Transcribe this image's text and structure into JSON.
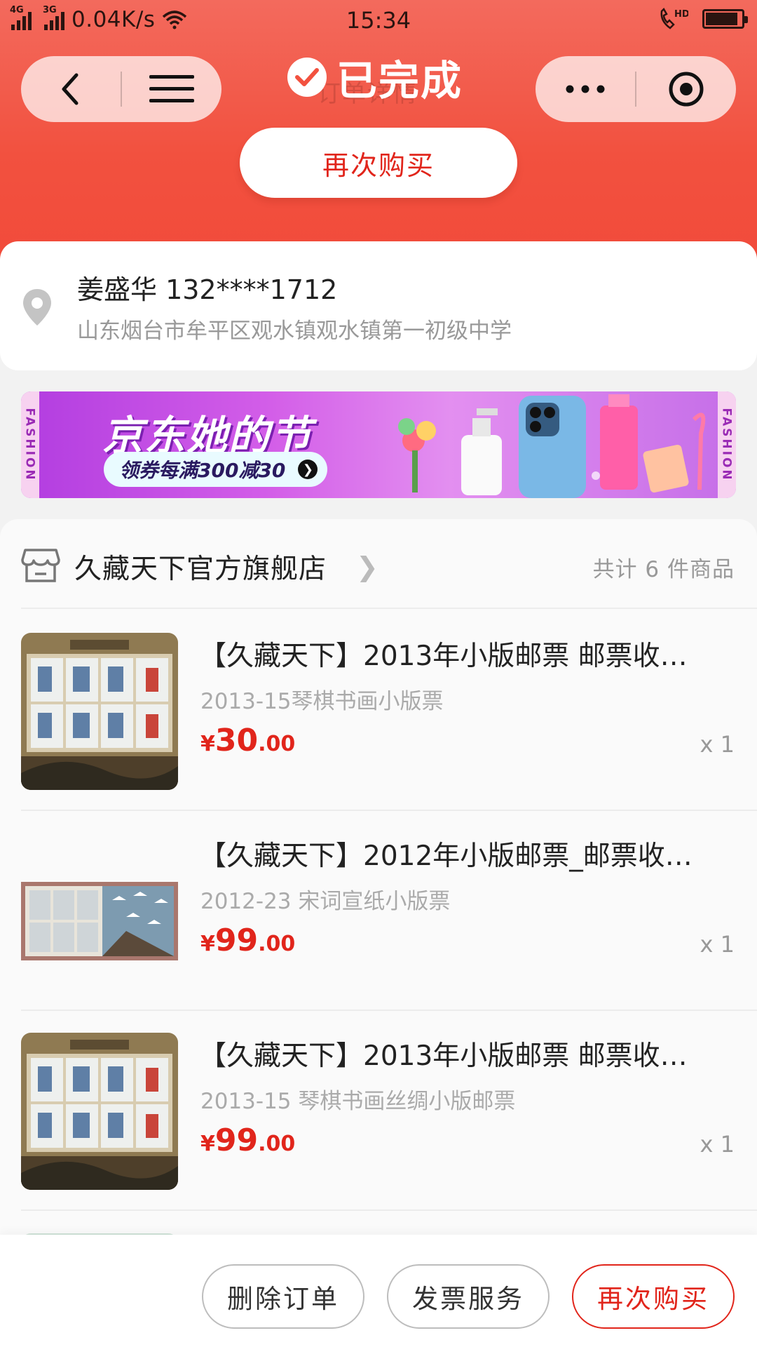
{
  "status_bar": {
    "network_1": "4G",
    "network_2": "3G",
    "speed": "0.04K/s",
    "time": "15:34"
  },
  "header": {
    "status": "已完成",
    "page_title": "订单详情",
    "buy_again": "再次购买"
  },
  "address": {
    "recipient": "姜盛华 132****1712",
    "detail": "山东烟台市牟平区观水镇观水镇第一初级中学"
  },
  "banner": {
    "title": "京东她的节",
    "subtitle": "领券每满300减30",
    "side_label": "FASHION"
  },
  "store": {
    "name": "久藏天下官方旗舰店",
    "item_count": "共计 6 件商品"
  },
  "items": [
    {
      "title": "【久藏天下】2013年小版邮票 邮票收…",
      "spec": "2013-15琴棋书画小版票",
      "currency": "¥",
      "price_int": "30",
      "price_dec": ".00",
      "qty": "x 1"
    },
    {
      "title": "【久藏天下】2012年小版邮票_邮票收…",
      "spec": "2012-23 宋词宣纸小版票",
      "currency": "¥",
      "price_int": "99",
      "price_dec": ".00",
      "qty": "x 1"
    },
    {
      "title": "【久藏天下】2013年小版邮票 邮票收…",
      "spec": "2013-15 琴棋书画丝绸小版邮票",
      "currency": "¥",
      "price_int": "99",
      "price_dec": ".00",
      "qty": "x 1"
    }
  ],
  "actions": {
    "delete_order": "删除订单",
    "invoice": "发票服务",
    "buy_again": "再次购买"
  },
  "colors": {
    "header_red": "#f2513f",
    "price_red": "#e1251b",
    "muted_text": "#999999"
  }
}
